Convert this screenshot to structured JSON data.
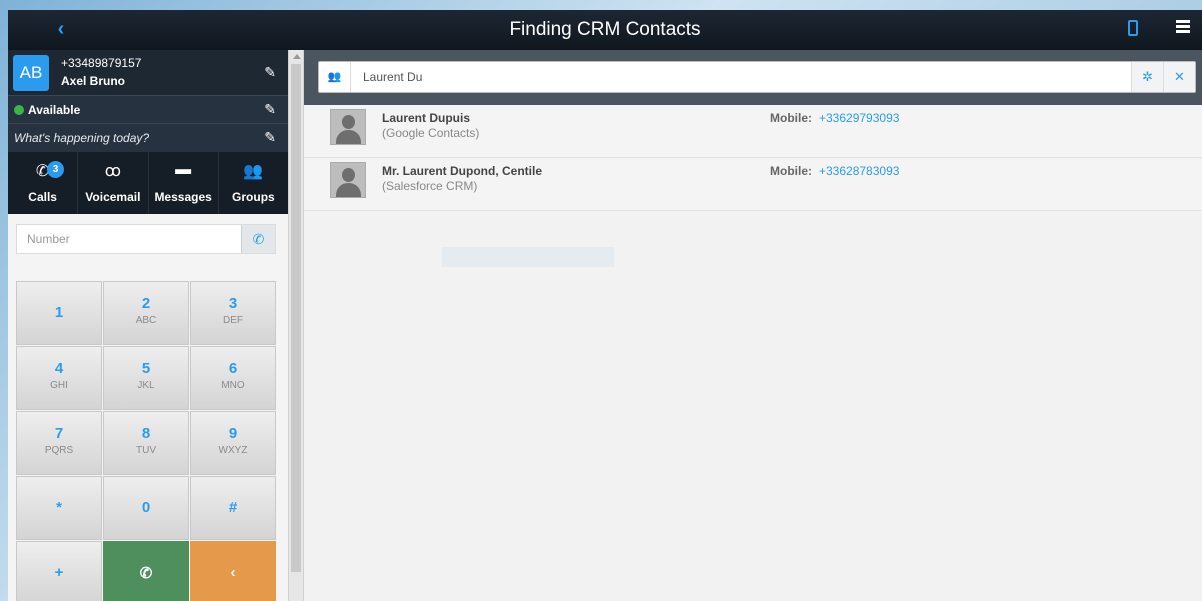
{
  "header": {
    "back_icon": "chevron-left-icon",
    "title": "Finding CRM Contacts",
    "phone_icon": "mobile-icon",
    "menu_icon": "hamburger-menu-icon"
  },
  "profile": {
    "initials": "AB",
    "number": "+33489879157",
    "name": "Axel Bruno",
    "status": "Available",
    "mood_placeholder": "What's happening today?"
  },
  "nav": {
    "calls_label": "Calls",
    "calls_badge": "3",
    "voicemail_label": "Voicemail",
    "messages_label": "Messages",
    "groups_label": "Groups"
  },
  "dialer": {
    "number_placeholder": "Number",
    "keys": [
      {
        "digit": "1",
        "sub": ""
      },
      {
        "digit": "2",
        "sub": "ABC"
      },
      {
        "digit": "3",
        "sub": "DEF"
      },
      {
        "digit": "4",
        "sub": "GHI"
      },
      {
        "digit": "5",
        "sub": "JKL"
      },
      {
        "digit": "6",
        "sub": "MNO"
      },
      {
        "digit": "7",
        "sub": "PQRS"
      },
      {
        "digit": "8",
        "sub": "TUV"
      },
      {
        "digit": "9",
        "sub": "WXYZ"
      },
      {
        "digit": "*",
        "sub": ""
      },
      {
        "digit": "0",
        "sub": ""
      },
      {
        "digit": "#",
        "sub": ""
      },
      {
        "digit": "+",
        "sub": ""
      },
      {
        "digit": "✆",
        "sub": ""
      },
      {
        "digit": "‹",
        "sub": ""
      }
    ]
  },
  "search": {
    "value": "Laurent Du"
  },
  "results": [
    {
      "name": "Laurent Dupuis",
      "source": "(Google Contacts)",
      "mobile_label": "Mobile:",
      "mobile": "+33629793093"
    },
    {
      "name": "Mr. Laurent Dupond, Centile",
      "source": "(Salesforce CRM)",
      "mobile_label": "Mobile:",
      "mobile": "+33628783093"
    }
  ],
  "colors": {
    "accent": "#2b9bf0",
    "call_green": "#4f8f5e",
    "backspace_orange": "#e49a4a",
    "available_green": "#3ab54a"
  }
}
